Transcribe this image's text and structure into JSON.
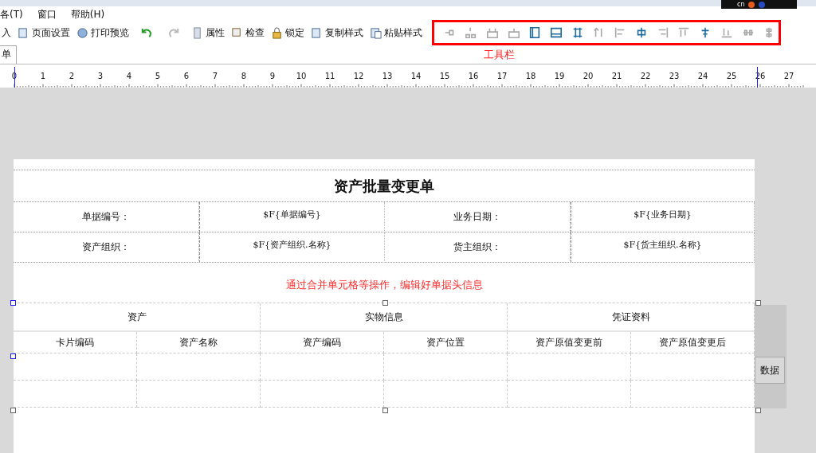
{
  "tray": {
    "text": "cn"
  },
  "menu": [
    "各(T)",
    "窗口",
    "帮助(H)"
  ],
  "toolbar": [
    {
      "kind": "text",
      "label": "入",
      "disabled": false
    },
    {
      "kind": "text",
      "label": "页面设置",
      "disabled": false
    },
    {
      "kind": "text",
      "label": "打印预览",
      "disabled": false
    },
    {
      "kind": "icon",
      "disabled": false
    },
    {
      "kind": "icon",
      "disabled": true
    },
    {
      "kind": "text",
      "label": "属性",
      "disabled": false
    },
    {
      "kind": "text",
      "label": "检查",
      "disabled": false
    },
    {
      "kind": "text",
      "label": "锁定",
      "disabled": false
    },
    {
      "kind": "text",
      "label": "复制样式",
      "disabled": false
    },
    {
      "kind": "text",
      "label": "粘贴样式",
      "disabled": false
    }
  ],
  "layout_tools": [
    {
      "disabled": true
    },
    {
      "disabled": true
    },
    {
      "disabled": true
    },
    {
      "disabled": true
    },
    {
      "disabled": false
    },
    {
      "disabled": false
    },
    {
      "disabled": false
    },
    {
      "disabled": true
    },
    {
      "disabled": true
    },
    {
      "disabled": false
    },
    {
      "disabled": true
    },
    {
      "disabled": true
    },
    {
      "disabled": false
    },
    {
      "disabled": true
    },
    {
      "disabled": true
    },
    {
      "disabled": true
    }
  ],
  "annotation": "工具栏",
  "tabs": [
    {
      "label": "单",
      "selected": true
    }
  ],
  "ruler": [
    "0",
    "1",
    "2",
    "3",
    "4",
    "5",
    "6",
    "7",
    "8",
    "9",
    "10",
    "11",
    "12",
    "13",
    "14",
    "15",
    "16",
    "17",
    "18",
    "19",
    "20",
    "21",
    "22",
    "23",
    "24",
    "25",
    "26",
    "27"
  ],
  "report": {
    "title": "资产批量变更单",
    "fields": [
      [
        "单据编号：",
        "$F{单据编号}",
        "业务日期：",
        "$F{业务日期}"
      ],
      [
        "资产组织：",
        "$F{资产组织.名称}",
        "货主组织：",
        "$F{货主组织.名称}"
      ]
    ],
    "note": "通过合并单元格等操作，编辑好单据头信息",
    "groups": [
      "资产",
      "实物信息",
      "凭证资料"
    ],
    "columns": [
      "卡片编码",
      "资产名称",
      "资产编码",
      "资产位置",
      "资产原值变更前",
      "资产原值变更后"
    ],
    "side_button": "数据"
  }
}
